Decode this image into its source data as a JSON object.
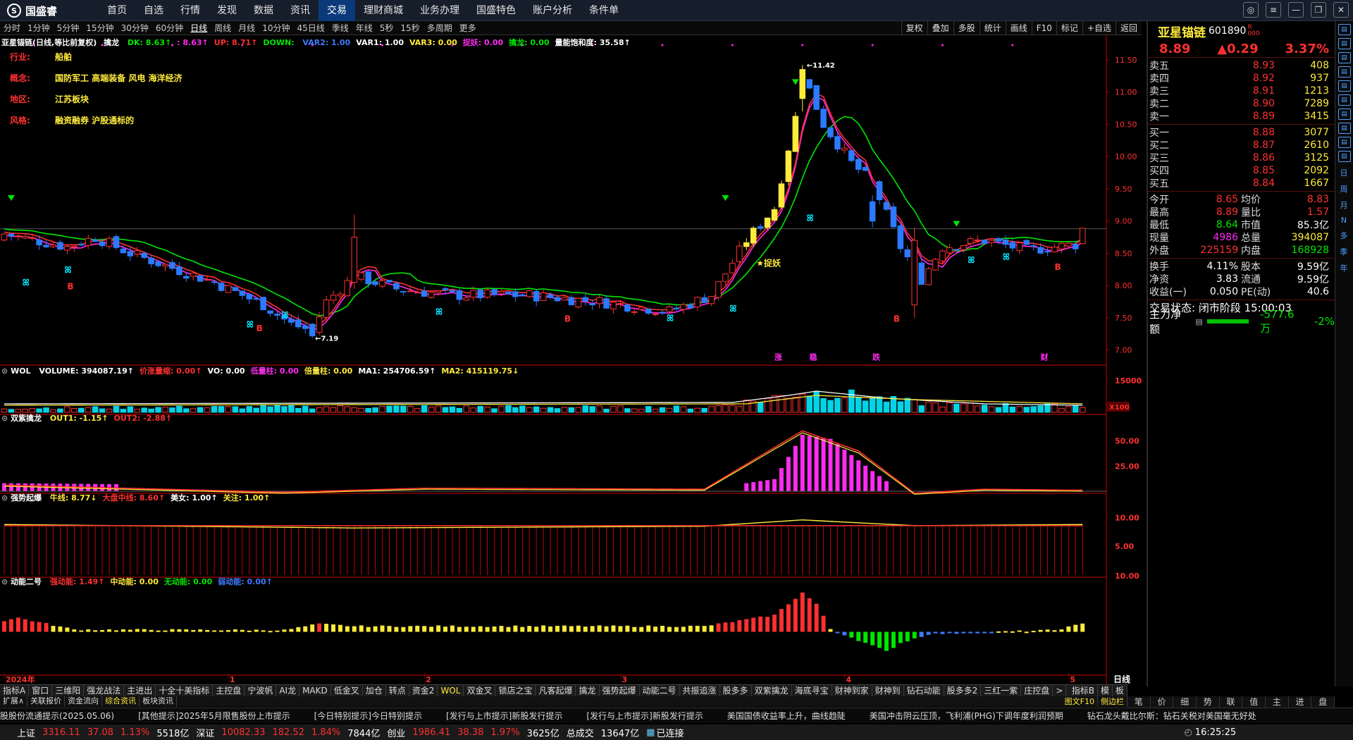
{
  "app": {
    "logo": "国盛睿",
    "nav": [
      "首页",
      "自选",
      "行情",
      "发现",
      "数据",
      "资讯",
      "交易",
      "理财商城",
      "业务办理",
      "国盛特色",
      "账户分析",
      "条件单"
    ],
    "active_nav": "交易"
  },
  "window_icons": [
    "chat-icon",
    "menu-icon",
    "minimize-icon",
    "restore-icon",
    "close-icon"
  ],
  "periods": [
    "分时",
    "1分钟",
    "5分钟",
    "15分钟",
    "30分钟",
    "60分钟",
    "日线",
    "周线",
    "月线",
    "10分钟",
    "45日线",
    "季线",
    "年线",
    "5秒",
    "15秒",
    "多周期",
    "更多"
  ],
  "active_period": "日线",
  "tools": [
    "复权",
    "叠加",
    "多股",
    "统计",
    "画线",
    "F10",
    "标记",
    "+自选",
    "返回"
  ],
  "main_info": {
    "title": "亚星锚链(日线,等比前复权)",
    "ind": "擒龙",
    "items": [
      {
        "t": "DK: 8.63↑",
        "c": "#00e600"
      },
      {
        "t": ": 8.63↑",
        "c": "#ff2bf0"
      },
      {
        "t": "UP: 8.71↑",
        "c": "#ff3030"
      },
      {
        "t": "DOWN: ",
        "c": "#00e600"
      },
      {
        "t": "VAR2: 1.00",
        "c": "#3d7bff"
      },
      {
        "t": "VAR1: 1.00",
        "c": "#ffffff"
      },
      {
        "t": "VAR3: 0.00",
        "c": "#ffeb3b"
      },
      {
        "t": "捉妖: 0.00",
        "c": "#ff2bf0"
      },
      {
        "t": "擒龙: 0.00",
        "c": "#00e600"
      },
      {
        "t": "量能饱和度: 35.58↑",
        "c": "#ffffff"
      }
    ]
  },
  "stock_info": [
    {
      "k": "行业:",
      "v": "船舶"
    },
    {
      "k": "概念:",
      "v": "国防军工 高端装备 风电 海洋经济"
    },
    {
      "k": "地区:",
      "v": "江苏板块"
    },
    {
      "k": "风格:",
      "v": "融资融券 沪股通标的"
    }
  ],
  "annotations": {
    "high": "11.42",
    "low": "7.19",
    "catch": "捉妖",
    "b": "B",
    "markers": [
      "涨",
      "稳",
      "跌",
      "财"
    ]
  },
  "y_axis_main": [
    "11.50",
    "11.00",
    "10.50",
    "10.00",
    "9.50",
    "9.00",
    "8.50",
    "8.00",
    "7.50",
    "7.00"
  ],
  "vol_info": {
    "name": "WOL",
    "items": [
      {
        "t": "VOLUME: 394087.19↑",
        "c": "#ffffff"
      },
      {
        "t": "价涨量缩: 0.00↑",
        "c": "#ff3030"
      },
      {
        "t": "VO: 0.00",
        "c": "#ffffff"
      },
      {
        "t": "低量柱: 0.00",
        "c": "#ff2bf0"
      },
      {
        "t": "倍量柱: 0.00",
        "c": "#ffeb3b"
      },
      {
        "t": "MA1: 254706.59↑",
        "c": "#ffffff"
      },
      {
        "t": "MA2: 415119.75↓",
        "c": "#ffeb3b"
      }
    ]
  },
  "vol_axis": [
    "15000",
    "X100"
  ],
  "ind2": {
    "name": "双紫擒龙",
    "items": [
      {
        "t": "OUT1: -1.15↑",
        "c": "#ffeb3b"
      },
      {
        "t": "OUT2: -2.88↑",
        "c": "#ff3030"
      }
    ]
  },
  "ind2_axis": [
    "50.00",
    "25.00"
  ],
  "ind3": {
    "name": "强势起爆",
    "items": [
      {
        "t": "牛线: 8.77↓",
        "c": "#ffeb3b"
      },
      {
        "t": "大盘中线: 8.60↑",
        "c": "#ff3030"
      },
      {
        "t": "美女: 1.00↑",
        "c": "#ffffff"
      },
      {
        "t": "关注: 1.00↑",
        "c": "#ffeb3b"
      }
    ]
  },
  "ind3_axis": [
    "10.00",
    "5.00"
  ],
  "ind4": {
    "name": "动能二号",
    "items": [
      {
        "t": "强动能: 1.49↑",
        "c": "#ff3030"
      },
      {
        "t": "中动能: 0.00",
        "c": "#ffeb3b"
      },
      {
        "t": "无动能: 0.00",
        "c": "#00e600"
      },
      {
        "t": "弱动能: 0.00↑",
        "c": "#3d7bff"
      }
    ]
  },
  "ind4_axis": [
    "10.00"
  ],
  "x_axis": [
    "2024年",
    "1",
    "2",
    "3",
    "4",
    "5"
  ],
  "x_period": "日线",
  "bottom_tabs": [
    "指标A",
    "窗口",
    "三维阳",
    "强龙战法",
    "主进出",
    "十全十美指标",
    "主控盘",
    "宁波帆",
    "AI龙",
    "MAKD",
    "低金叉",
    "加仓",
    "转点",
    "资金2",
    "WOL",
    "双金叉",
    "锁店之宝",
    "凡客起爆",
    "擒龙",
    "强势起爆",
    "动能二号",
    "共振追涨",
    "股多多",
    "双紫擒龙",
    "海底寻宝",
    "财神到家",
    "财神到",
    "钻石动能",
    "股多多2",
    "三红一紫",
    "庄控盘"
  ],
  "active_tab": "WOL",
  "bottom_tabs_right": [
    "指标B",
    "模",
    "板"
  ],
  "sub_tabs": [
    "扩展∧",
    "关联报价",
    "资金流向",
    "综合资讯",
    "板块资讯"
  ],
  "right_sub": [
    "图文F10",
    "侧边栏"
  ],
  "news": [
    "股股份流通提示(2025.05.06)",
    "[其他提示]2025年5月限售股份上市提示",
    "[今日特别提示]今日特别提示",
    "[发行与上市提示]新股发行提示",
    "[发行与上市提示]新股发行提示",
    "美国国债收益率上升，曲线趋陡",
    "美国冲击阴云压顶，飞利浦(PHG)下调年度利润预期",
    "钻石龙头戴比尔斯：钻石关税对美国毫无好处"
  ],
  "status": {
    "sh_name": "上证",
    "sh": "3316.11",
    "sh_chg": "37.08",
    "sh_pct": "1.13%",
    "sh_amt": "5518亿",
    "sz_name": "深证",
    "sz": "10082.33",
    "sz_chg": "182.52",
    "sz_pct": "1.84%",
    "sz_amt": "7844亿",
    "cy_name": "创业",
    "cy": "1986.41",
    "cy_chg": "38.38",
    "cy_pct": "1.97%",
    "cy_amt": "3625亿",
    "total_label": "总成交",
    "total": "13647亿",
    "conn": "已连接",
    "time": "16:25:25"
  },
  "quote": {
    "name": "亚星锚链",
    "code": "601890",
    "price": "8.89",
    "change": "▲0.29",
    "pct": "3.37%",
    "asks": [
      {
        "l": "卖五",
        "p": "8.93",
        "v": "408"
      },
      {
        "l": "卖四",
        "p": "8.92",
        "v": "937"
      },
      {
        "l": "卖三",
        "p": "8.91",
        "v": "1213"
      },
      {
        "l": "卖二",
        "p": "8.90",
        "v": "7289"
      },
      {
        "l": "卖一",
        "p": "8.89",
        "v": "3415"
      }
    ],
    "bids": [
      {
        "l": "买一",
        "p": "8.88",
        "v": "3077"
      },
      {
        "l": "买二",
        "p": "8.87",
        "v": "2610"
      },
      {
        "l": "买三",
        "p": "8.86",
        "v": "3125"
      },
      {
        "l": "买四",
        "p": "8.85",
        "v": "2092"
      },
      {
        "l": "买五",
        "p": "8.84",
        "v": "1667"
      }
    ],
    "stats": [
      [
        "今开",
        "8.65",
        "均价",
        "8.83"
      ],
      [
        "最高",
        "8.89",
        "量比",
        "1.57"
      ],
      [
        "最低",
        "8.64",
        "市值",
        "85.3亿"
      ],
      [
        "现量",
        "4986",
        "总量",
        "394087"
      ],
      [
        "外盘",
        "225159",
        "内盘",
        "168928"
      ]
    ],
    "stats2": [
      [
        "换手",
        "4.11%",
        "股本",
        "9.59亿"
      ],
      [
        "净资",
        "3.83",
        "流通",
        "9.59亿"
      ],
      [
        "收益(一)",
        "0.050",
        "PE(动)",
        "40.6"
      ]
    ],
    "phase": "交易状态: 闭市阶段 15:00:03",
    "main_net_label": "主力净额",
    "main_net": "-577.6万",
    "main_net_pct": "-2%"
  },
  "side_text": [
    "日",
    "周",
    "月",
    "N",
    "多",
    "季",
    "年"
  ],
  "right_bottom_tabs": [
    "笔",
    "价",
    "细",
    "势",
    "联",
    "值",
    "主",
    "进",
    "盘"
  ]
}
